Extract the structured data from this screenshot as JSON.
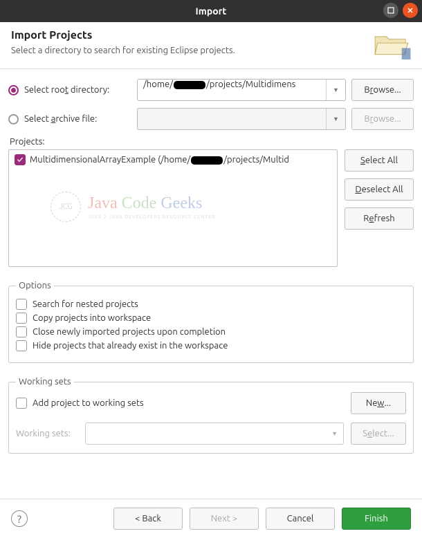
{
  "window": {
    "title": "Import"
  },
  "header": {
    "title": "Import Projects",
    "subtitle": "Select a directory to search for existing Eclipse projects."
  },
  "source": {
    "root_label_pre": "Select roo",
    "root_label_u": "t",
    "root_label_post": " directory:",
    "root_value_pre": "/home/",
    "root_value_post": "/projects/Multidimens",
    "archive_label_pre": "Select ",
    "archive_label_u": "a",
    "archive_label_post": "rchive file:",
    "archive_value": "",
    "browse_label_pre": "B",
    "browse_label_u": "r",
    "browse_label_post": "owse..."
  },
  "projects": {
    "label_u": "P",
    "label_post": "rojects:",
    "items": [
      {
        "name_pre": "MultidimensionalArrayExample (/home/",
        "name_post": "/projects/Multid",
        "checked": true
      }
    ],
    "select_all_u": "S",
    "select_all_post": "elect All",
    "deselect_all_u": "D",
    "deselect_all_post": "eselect All",
    "refresh_pre": "R",
    "refresh_u": "e",
    "refresh_post": "fresh"
  },
  "watermark": {
    "badge": "JCG",
    "java": "Java",
    "code": "Code",
    "geeks": "Geeks",
    "sub": "JAVA 2 JAVA DEVELOPERS RESOURCE CENTER"
  },
  "options": {
    "legend": "Options",
    "nested": "Search for nested projects",
    "copy_u": "C",
    "copy_post": "opy projects into workspace",
    "close": "Close newly imported projects upon completion",
    "hide_pre": "H",
    "hide_u": "i",
    "hide_post": "de projects that already exist in the workspace"
  },
  "working_sets": {
    "legend": "Working sets",
    "add_pre": "Add projec",
    "add_u": "t",
    "add_post": " to working sets",
    "new_pre": "Ne",
    "new_u": "w",
    "new_post": "...",
    "label_pre": "W",
    "label_u": "o",
    "label_post": "rking sets:",
    "select_pre": "S",
    "select_u": "e",
    "select_post": "lect..."
  },
  "footer": {
    "back": "< Back",
    "next": "Next >",
    "cancel": "Cancel",
    "finish": "Finish"
  }
}
